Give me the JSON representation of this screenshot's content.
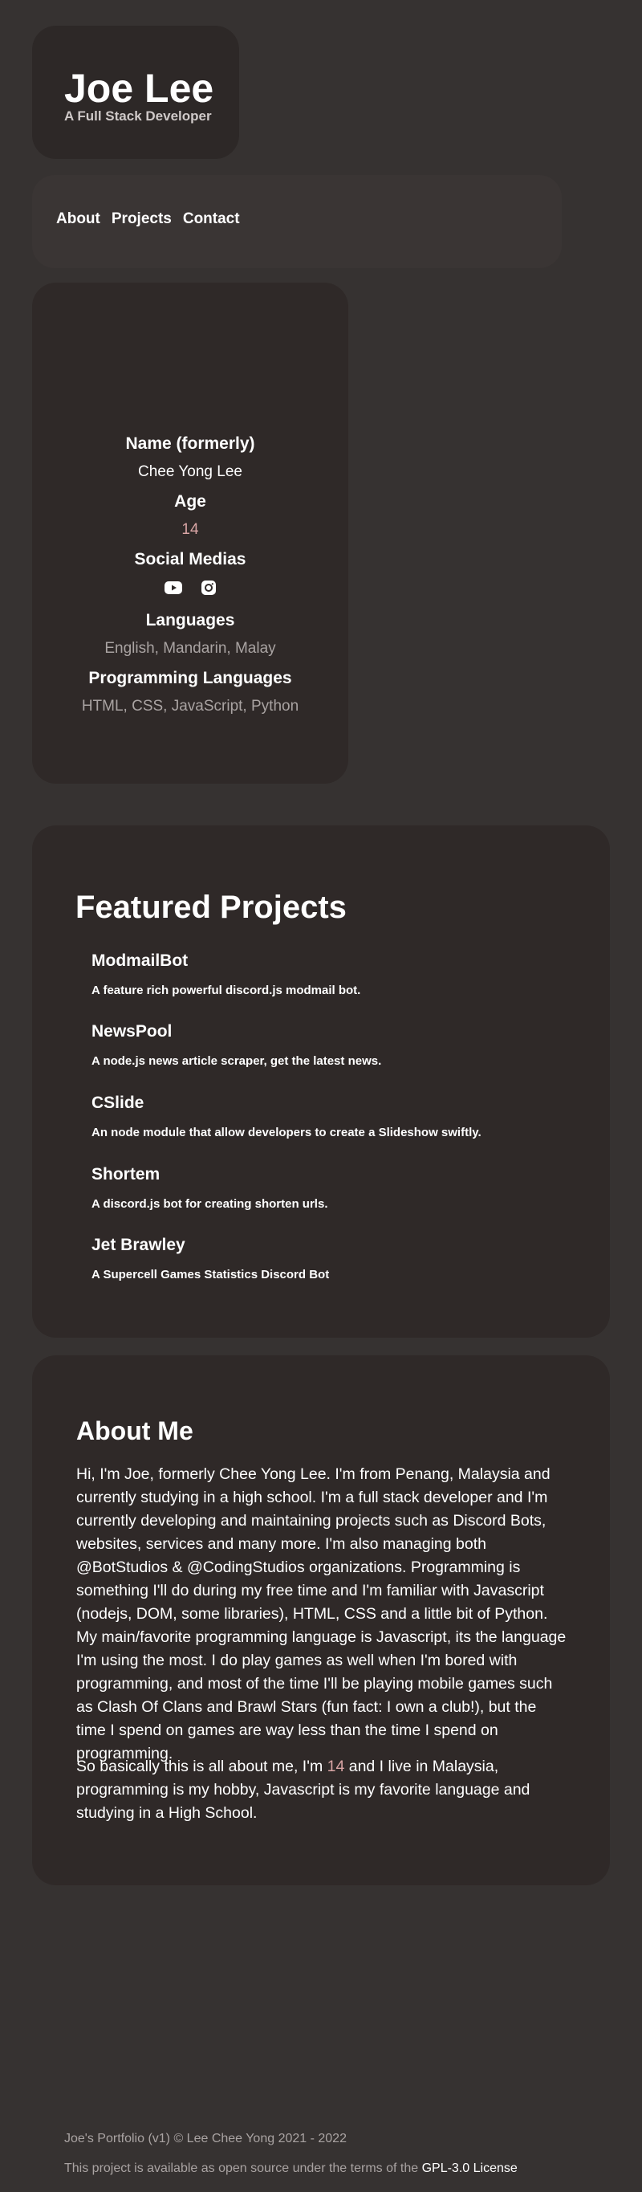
{
  "header": {
    "name": "Joe Lee",
    "tagline": "A Full Stack Developer"
  },
  "nav": {
    "items": [
      "About",
      "Projects",
      "Contact"
    ]
  },
  "info": {
    "name_heading": "Name (formerly)",
    "name_value": "Chee Yong Lee",
    "age_heading": "Age",
    "age_value": "14",
    "social_heading": "Social Medias",
    "social_icons": [
      "youtube-icon",
      "instagram-icon"
    ],
    "languages_heading": "Languages",
    "languages_value": "English, Mandarin, Malay",
    "prog_heading": "Programming Languages",
    "prog_value": "HTML, CSS, JavaScript, Python"
  },
  "projects": {
    "heading": "Featured Projects",
    "items": [
      {
        "title": "ModmailBot",
        "desc": "A feature rich powerful discord.js modmail bot."
      },
      {
        "title": "NewsPool",
        "desc": "A node.js news article scraper, get the latest news."
      },
      {
        "title": "CSlide",
        "desc": "An node module that allow developers to create a Slideshow swiftly."
      },
      {
        "title": "Shortem",
        "desc": "A discord.js bot for creating shorten urls."
      },
      {
        "title": "Jet Brawley",
        "desc": "A Supercell Games Statistics Discord Bot"
      }
    ]
  },
  "about": {
    "heading": "About Me",
    "paragraph1": "Hi, I'm Joe, formerly Chee Yong Lee. I'm from Penang, Malaysia and currently studying in a high school. I'm a full stack developer and I'm currently developing and maintaining projects such as Discord Bots, websites, services and many more. I'm also managing both @BotStudios & @CodingStudios organizations. Programming is something I'll do during my free time and I'm familiar with Javascript (nodejs, DOM, some libraries), HTML, CSS and a little bit of Python. My main/favorite programming language is Javascript, its the language I'm using the most. I do play games as well when I'm bored with programming, and most of the time I'll be playing mobile games such as Clash Of Clans and Brawl Stars (fun fact: I own a club!), but the time I spend on games are way less than the time I spend on programming.",
    "paragraph2_before": "So basically this is all about me, I'm ",
    "paragraph2_age": "14",
    "paragraph2_after": " and I live in Malaysia, programming is my hobby, Javascript is my favorite language and studying in a High School."
  },
  "footer": {
    "copyright": "Joe's Portfolio (v1) © Lee Chee Yong 2021 - 2022",
    "license_text": "This project is available as open source under the terms of the ",
    "license_link": "GPL-3.0 License"
  },
  "colors": {
    "background": "#363231",
    "card": "#2f2928",
    "nav_card": "#3a3534",
    "accent": "#d9a5a5",
    "muted": "#a9a3a2"
  }
}
